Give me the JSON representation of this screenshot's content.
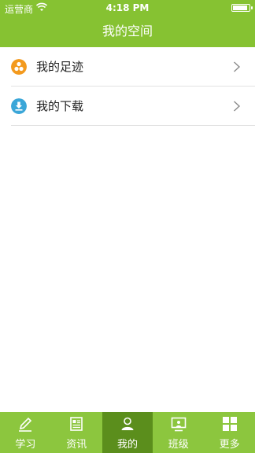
{
  "status_bar": {
    "carrier": "运营商",
    "time": "4:18 PM",
    "battery_level": 0.9
  },
  "nav": {
    "title": "我的空间"
  },
  "list": [
    {
      "label": "我的足迹",
      "icon": "footprint-icon",
      "color": "#f39a1e"
    },
    {
      "label": "我的下载",
      "icon": "download-icon",
      "color": "#3aa6d8"
    }
  ],
  "tabs": [
    {
      "label": "学习",
      "icon": "pencil-icon",
      "active": false
    },
    {
      "label": "资讯",
      "icon": "news-icon",
      "active": false
    },
    {
      "label": "我的",
      "icon": "person-icon",
      "active": true
    },
    {
      "label": "班级",
      "icon": "classroom-icon",
      "active": false
    },
    {
      "label": "更多",
      "icon": "grid-icon",
      "active": false
    }
  ],
  "colors": {
    "brand_green": "#86c232",
    "tab_active": "#5b8e1c"
  }
}
